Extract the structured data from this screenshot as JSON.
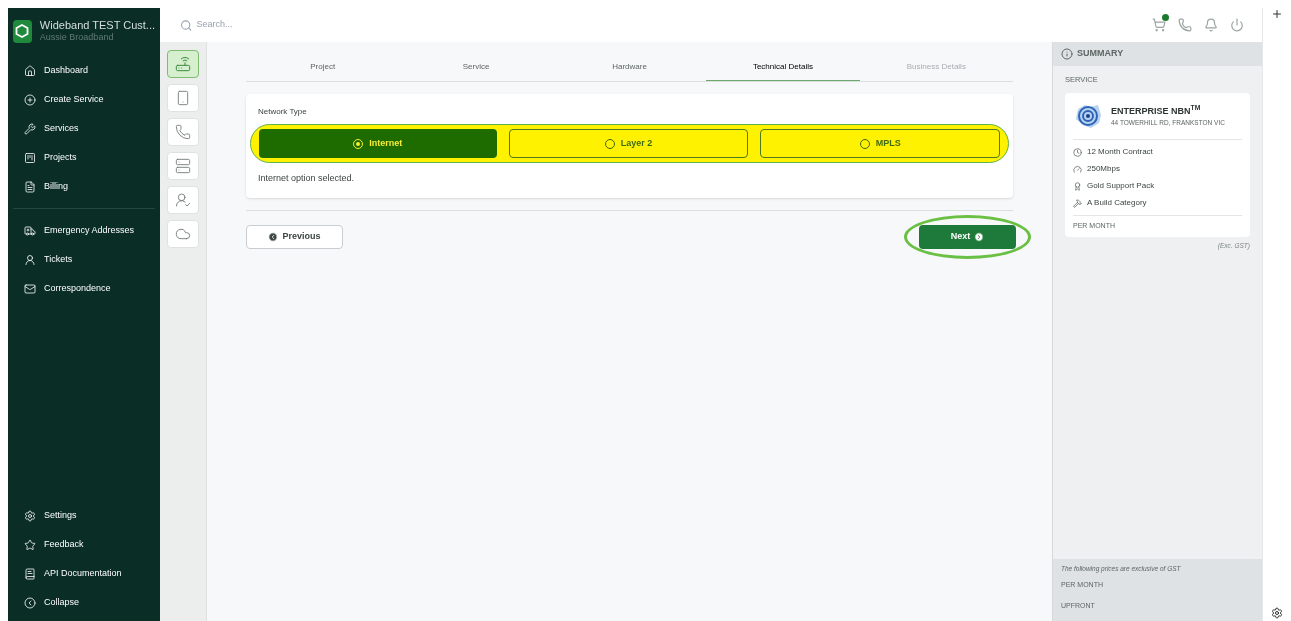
{
  "account": {
    "name": "Wideband TEST Cust...",
    "provider": "Aussie Broadband"
  },
  "search": {
    "placeholder": "Search..."
  },
  "header": {
    "cart_has_items": true
  },
  "sidebar": {
    "main_items": [
      {
        "label": "Dashboard"
      },
      {
        "label": "Create Service"
      },
      {
        "label": "Services"
      },
      {
        "label": "Projects"
      },
      {
        "label": "Billing"
      }
    ],
    "support_items": [
      {
        "label": "Emergency Addresses"
      },
      {
        "label": "Tickets"
      },
      {
        "label": "Correspondence"
      }
    ],
    "footer_items": [
      {
        "label": "Settings"
      },
      {
        "label": "Feedback"
      },
      {
        "label": "API Documentation"
      },
      {
        "label": "Collapse"
      }
    ]
  },
  "service_types": [
    {
      "selected": true
    },
    {
      "selected": false
    },
    {
      "selected": false
    },
    {
      "selected": false
    },
    {
      "selected": false
    },
    {
      "selected": false
    }
  ],
  "steps": [
    {
      "label": "Project",
      "selected": false,
      "disabled": false
    },
    {
      "label": "Service",
      "selected": false,
      "disabled": false
    },
    {
      "label": "Hardware",
      "selected": false,
      "disabled": false
    },
    {
      "label": "Technical Details",
      "selected": true,
      "disabled": false
    },
    {
      "label": "Business Details",
      "selected": false,
      "disabled": true
    }
  ],
  "network_type": {
    "label": "Network Type",
    "options": [
      {
        "label": "Internet",
        "selected": true
      },
      {
        "label": "Layer 2",
        "selected": false
      },
      {
        "label": "MPLS",
        "selected": false
      }
    ],
    "message": "Internet option selected."
  },
  "buttons": {
    "previous": "Previous",
    "next": "Next"
  },
  "summary": {
    "title": "SUMMARY",
    "section": "SERVICE",
    "product": "ENTERPRISE NBN$^{TM}$",
    "address": "44 TOWERHILL RD, FRANKSTON VIC",
    "features": [
      "12 Month Contract",
      "250Mbps",
      "Gold Support Pack",
      "A Build Category"
    ],
    "period": "PER MONTH",
    "tax_note": "(Exc. GST)",
    "footer": {
      "note": "The following prices are exclusive of GST",
      "lines": [
        "PER MONTH",
        "UPFRONT"
      ]
    }
  }
}
